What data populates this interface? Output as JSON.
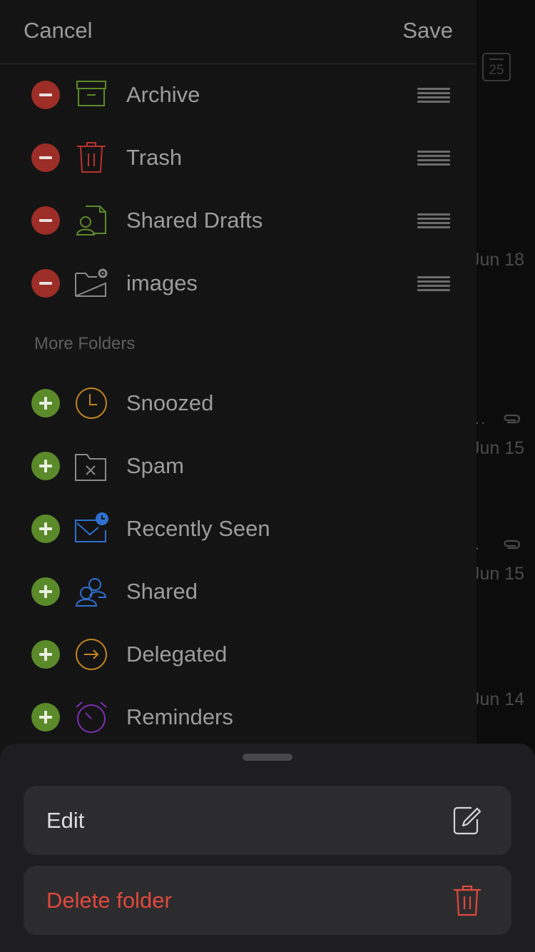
{
  "header": {
    "cancel_label": "Cancel",
    "save_label": "Save"
  },
  "favorites": [
    {
      "label": "Archive",
      "icon": "archive-box-icon",
      "color": "#5c8a2a"
    },
    {
      "label": "Trash",
      "icon": "trash-icon",
      "color": "#b8332b"
    },
    {
      "label": "Shared Drafts",
      "icon": "shared-drafts-icon",
      "color": "#5c8a2a"
    },
    {
      "label": "images",
      "icon": "folder-gear-icon",
      "color": "#8a8a8a"
    }
  ],
  "more_folders": {
    "title": "More Folders",
    "items": [
      {
        "label": "Snoozed",
        "icon": "clock-icon",
        "color": "#c2861f"
      },
      {
        "label": "Spam",
        "icon": "spam-folder-icon",
        "color": "#8a8a8a"
      },
      {
        "label": "Recently Seen",
        "icon": "recently-seen-envelope-icon",
        "color": "#2f6fd0"
      },
      {
        "label": "Shared",
        "icon": "shared-people-icon",
        "color": "#2f6fd0"
      },
      {
        "label": "Delegated",
        "icon": "delegated-arrow-icon",
        "color": "#c2861f"
      },
      {
        "label": "Reminders",
        "icon": "alarm-clock-icon",
        "color": "#7b2fb0"
      }
    ]
  },
  "background_list": {
    "calendar_day": "25",
    "dates": [
      "Jun 18",
      "Jun 15",
      "Jun 15",
      "Jun 14"
    ]
  },
  "sheet": {
    "edit_label": "Edit",
    "delete_label": "Delete folder",
    "delete_color": "#e0483d"
  }
}
